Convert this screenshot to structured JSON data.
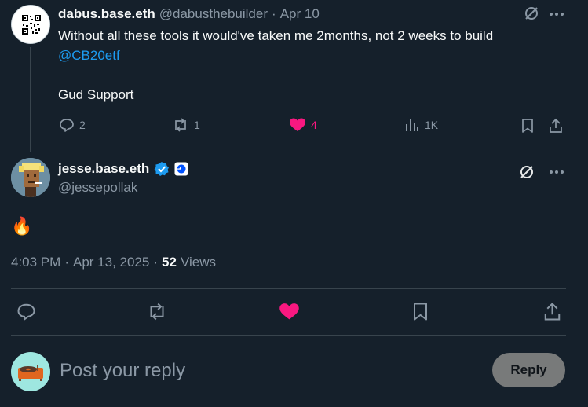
{
  "parent_post": {
    "display_name": "dabus.base.eth",
    "handle": "@dabusthebuilder",
    "separator": "·",
    "date": "Apr 10",
    "text_line1": "Without all these tools it would've taken me 2months, not 2 weeks to build",
    "mention": "@CB20etf",
    "text_line2": "Gud Support",
    "replies": "2",
    "reposts": "1",
    "likes": "4",
    "views": "1K"
  },
  "main_post": {
    "display_name": "jesse.base.eth",
    "handle": "@jessepollak",
    "body_emoji": "🔥",
    "time": "4:03 PM",
    "separator": "·",
    "date": "Apr 13, 2025",
    "views_count": "52",
    "views_label": "Views"
  },
  "reply_box": {
    "placeholder": "Post your reply",
    "button_label": "Reply"
  },
  "colors": {
    "background": "#15202b",
    "like_active": "#f91880",
    "verified": "#1d9bf0",
    "link": "#1d9bf0"
  },
  "icons": [
    "grok-icon",
    "more-icon",
    "reply-icon",
    "repost-icon",
    "like-icon",
    "views-icon",
    "bookmark-icon",
    "share-icon",
    "verified-badge-icon",
    "affiliate-badge-icon"
  ]
}
